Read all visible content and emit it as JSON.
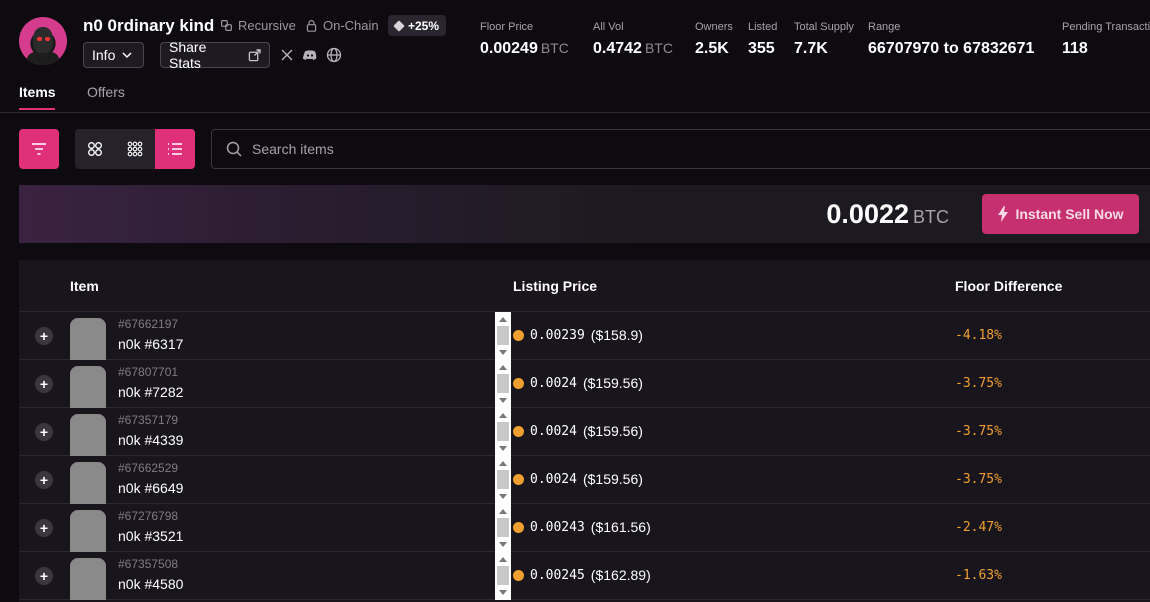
{
  "header": {
    "collection_name": "n0 0rdinary kind",
    "tag_recursive": "Recursive",
    "tag_onchain": "On-Chain",
    "pct_badge": "+25%",
    "info_label": "Info",
    "share_label": "Share Stats"
  },
  "stats": [
    {
      "label": "Floor Price",
      "value": "0.00249",
      "unit": "BTC"
    },
    {
      "label": "All Vol",
      "value": "0.4742",
      "unit": "BTC"
    },
    {
      "label": "Owners",
      "value": "2.5K"
    },
    {
      "label": "Listed",
      "value": "355"
    },
    {
      "label": "Total Supply",
      "value": "7.7K"
    },
    {
      "label": "Range",
      "value": "66707970 to 67832671"
    },
    {
      "label": "Pending Transactio",
      "value": "118"
    }
  ],
  "tabs": [
    {
      "label": "Items",
      "active": true
    },
    {
      "label": "Offers",
      "active": false
    }
  ],
  "search": {
    "placeholder": "Search items"
  },
  "banner": {
    "price": "0.0022",
    "unit": "BTC",
    "sell_label": "Instant Sell Now"
  },
  "table": {
    "headers": [
      "Item",
      "Listing Price",
      "Floor Difference"
    ],
    "rows": [
      {
        "inscription": "#67662197",
        "name": "n0k #6317",
        "btc": "0.00239",
        "usd": "($158.9)",
        "diff": "-4.18%"
      },
      {
        "inscription": "#67807701",
        "name": "n0k #7282",
        "btc": "0.0024",
        "usd": "($159.56)",
        "diff": "-3.75%"
      },
      {
        "inscription": "#67357179",
        "name": "n0k #4339",
        "btc": "0.0024",
        "usd": "($159.56)",
        "diff": "-3.75%"
      },
      {
        "inscription": "#67662529",
        "name": "n0k #6649",
        "btc": "0.0024",
        "usd": "($159.56)",
        "diff": "-3.75%"
      },
      {
        "inscription": "#67276798",
        "name": "n0k #3521",
        "btc": "0.00243",
        "usd": "($161.56)",
        "diff": "-2.47%"
      },
      {
        "inscription": "#67357508",
        "name": "n0k #4580",
        "btc": "0.00245",
        "usd": "($162.89)",
        "diff": "-1.63%"
      }
    ]
  },
  "colors": {
    "accent": "#e0307a",
    "diff": "#f0a030",
    "background": "#0e0b10"
  },
  "icons": [
    "filter-icon",
    "grid-large-icon",
    "grid-small-icon",
    "list-icon",
    "search-icon",
    "lightning-icon",
    "x-twitter-icon",
    "discord-icon",
    "globe-icon",
    "lock-icon",
    "recursive-icon",
    "chevron-down-icon",
    "share-icon",
    "expand-plus-icon"
  ]
}
